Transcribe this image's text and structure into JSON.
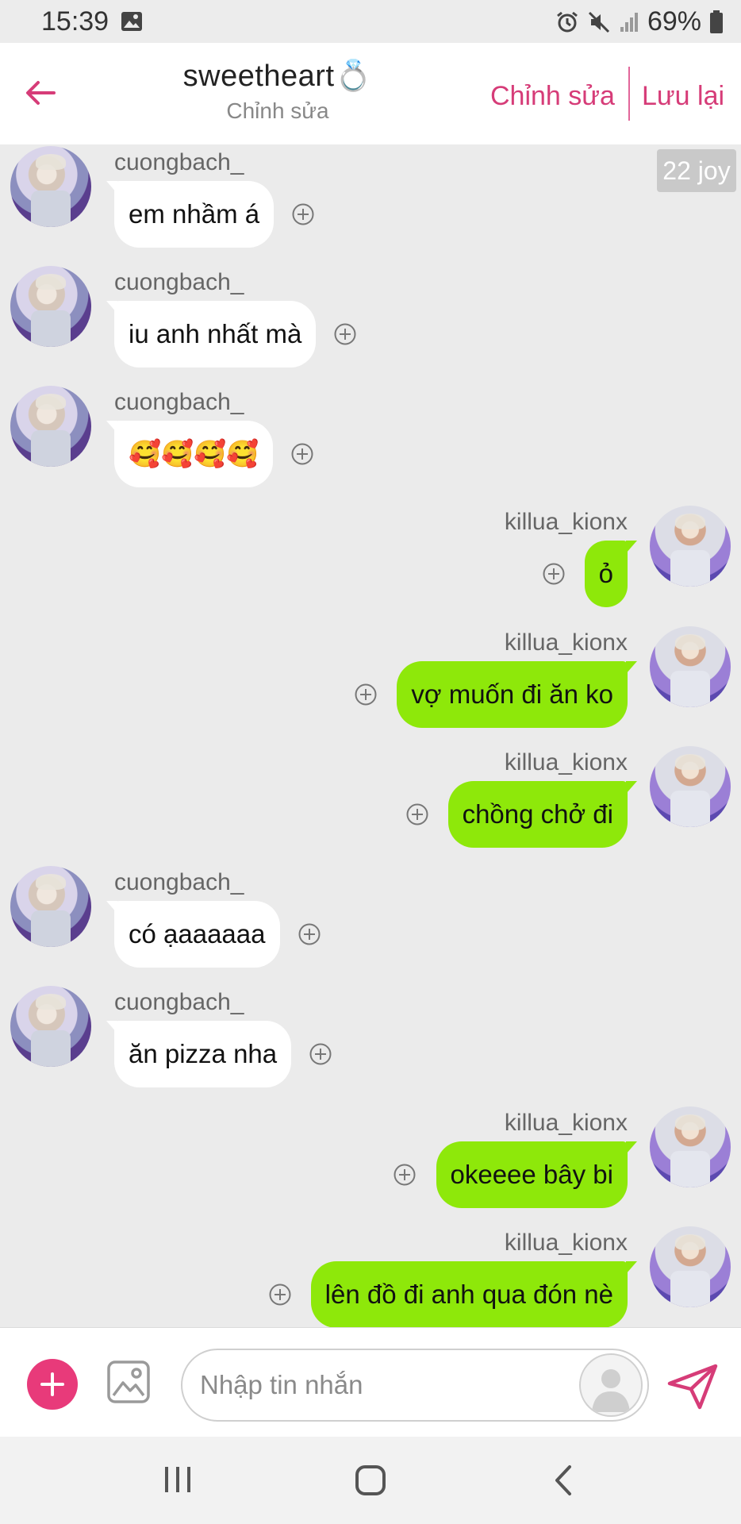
{
  "status_bar": {
    "time": "15:39",
    "battery": "69%",
    "icons": [
      "image-icon",
      "alarm-icon",
      "mute-icon",
      "signal-icon",
      "battery-icon"
    ]
  },
  "header": {
    "title": "sweetheart💍",
    "subtitle": "Chỉnh sửa",
    "edit_label": "Chỉnh sửa",
    "save_label": "Lưu lại",
    "accent_color": "#d63c78"
  },
  "chat": {
    "joy_badge": "22 joy",
    "messages": [
      {
        "side": "left",
        "user": "cuongbach_",
        "text": "em nhầm á"
      },
      {
        "side": "left",
        "user": "cuongbach_",
        "text": "iu anh nhất mà"
      },
      {
        "side": "left",
        "user": "cuongbach_",
        "text": "🥰🥰🥰🥰"
      },
      {
        "side": "right",
        "user": "killua_kionx",
        "text": "ỏ"
      },
      {
        "side": "right",
        "user": "killua_kionx",
        "text": "vợ muốn đi ăn ko"
      },
      {
        "side": "right",
        "user": "killua_kionx",
        "text": "chồng chở đi"
      },
      {
        "side": "left",
        "user": "cuongbach_",
        "text": "có ạaaaaaa"
      },
      {
        "side": "left",
        "user": "cuongbach_",
        "text": "ăn pizza nha"
      },
      {
        "side": "right",
        "user": "killua_kionx",
        "text": "okeeee bây bi"
      },
      {
        "side": "right",
        "user": "killua_kionx",
        "text": "lên đồ đi anh qua đón nè"
      }
    ],
    "colors": {
      "sent_bubble": "#8ee80a",
      "received_bubble": "#ffffff",
      "background": "#ebebeb"
    }
  },
  "input_bar": {
    "placeholder": "Nhập tin nhắn",
    "value": ""
  },
  "nav_bar": {
    "items": [
      "recents-icon",
      "home-icon",
      "back-icon"
    ]
  }
}
